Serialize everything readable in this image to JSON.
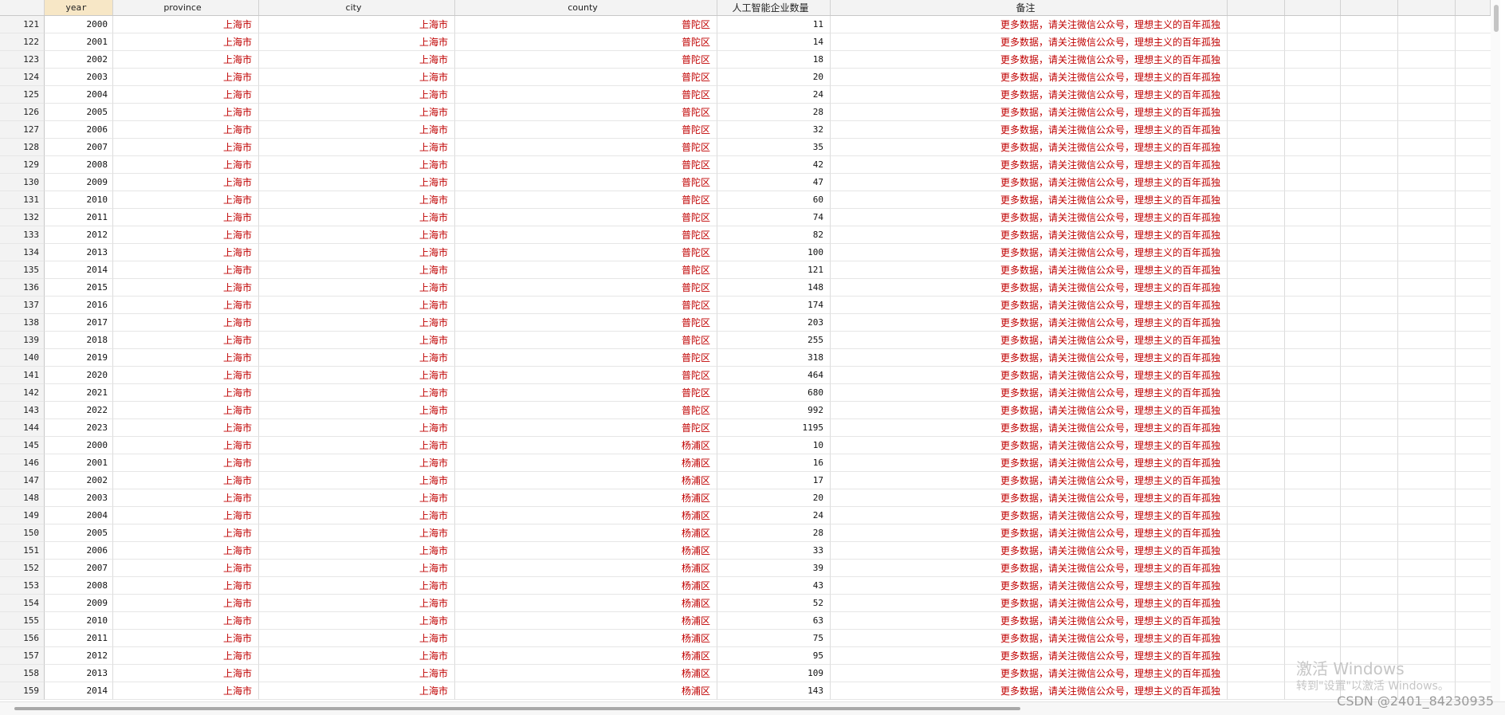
{
  "columns": [
    "year",
    "province",
    "city",
    "county",
    "人工智能企业数量",
    "备注"
  ],
  "rows": [
    {
      "rn": "121",
      "year": "2000",
      "province": "上海市",
      "city": "上海市",
      "county": "普陀区",
      "count": "11",
      "note": "更多数据，请关注微信公众号，理想主义的百年孤独"
    },
    {
      "rn": "122",
      "year": "2001",
      "province": "上海市",
      "city": "上海市",
      "county": "普陀区",
      "count": "14",
      "note": "更多数据，请关注微信公众号，理想主义的百年孤独"
    },
    {
      "rn": "123",
      "year": "2002",
      "province": "上海市",
      "city": "上海市",
      "county": "普陀区",
      "count": "18",
      "note": "更多数据，请关注微信公众号，理想主义的百年孤独"
    },
    {
      "rn": "124",
      "year": "2003",
      "province": "上海市",
      "city": "上海市",
      "county": "普陀区",
      "count": "20",
      "note": "更多数据，请关注微信公众号，理想主义的百年孤独"
    },
    {
      "rn": "125",
      "year": "2004",
      "province": "上海市",
      "city": "上海市",
      "county": "普陀区",
      "count": "24",
      "note": "更多数据，请关注微信公众号，理想主义的百年孤独"
    },
    {
      "rn": "126",
      "year": "2005",
      "province": "上海市",
      "city": "上海市",
      "county": "普陀区",
      "count": "28",
      "note": "更多数据，请关注微信公众号，理想主义的百年孤独"
    },
    {
      "rn": "127",
      "year": "2006",
      "province": "上海市",
      "city": "上海市",
      "county": "普陀区",
      "count": "32",
      "note": "更多数据，请关注微信公众号，理想主义的百年孤独"
    },
    {
      "rn": "128",
      "year": "2007",
      "province": "上海市",
      "city": "上海市",
      "county": "普陀区",
      "count": "35",
      "note": "更多数据，请关注微信公众号，理想主义的百年孤独"
    },
    {
      "rn": "129",
      "year": "2008",
      "province": "上海市",
      "city": "上海市",
      "county": "普陀区",
      "count": "42",
      "note": "更多数据，请关注微信公众号，理想主义的百年孤独"
    },
    {
      "rn": "130",
      "year": "2009",
      "province": "上海市",
      "city": "上海市",
      "county": "普陀区",
      "count": "47",
      "note": "更多数据，请关注微信公众号，理想主义的百年孤独"
    },
    {
      "rn": "131",
      "year": "2010",
      "province": "上海市",
      "city": "上海市",
      "county": "普陀区",
      "count": "60",
      "note": "更多数据，请关注微信公众号，理想主义的百年孤独"
    },
    {
      "rn": "132",
      "year": "2011",
      "province": "上海市",
      "city": "上海市",
      "county": "普陀区",
      "count": "74",
      "note": "更多数据，请关注微信公众号，理想主义的百年孤独"
    },
    {
      "rn": "133",
      "year": "2012",
      "province": "上海市",
      "city": "上海市",
      "county": "普陀区",
      "count": "82",
      "note": "更多数据，请关注微信公众号，理想主义的百年孤独"
    },
    {
      "rn": "134",
      "year": "2013",
      "province": "上海市",
      "city": "上海市",
      "county": "普陀区",
      "count": "100",
      "note": "更多数据，请关注微信公众号，理想主义的百年孤独"
    },
    {
      "rn": "135",
      "year": "2014",
      "province": "上海市",
      "city": "上海市",
      "county": "普陀区",
      "count": "121",
      "note": "更多数据，请关注微信公众号，理想主义的百年孤独"
    },
    {
      "rn": "136",
      "year": "2015",
      "province": "上海市",
      "city": "上海市",
      "county": "普陀区",
      "count": "148",
      "note": "更多数据，请关注微信公众号，理想主义的百年孤独"
    },
    {
      "rn": "137",
      "year": "2016",
      "province": "上海市",
      "city": "上海市",
      "county": "普陀区",
      "count": "174",
      "note": "更多数据，请关注微信公众号，理想主义的百年孤独"
    },
    {
      "rn": "138",
      "year": "2017",
      "province": "上海市",
      "city": "上海市",
      "county": "普陀区",
      "count": "203",
      "note": "更多数据，请关注微信公众号，理想主义的百年孤独"
    },
    {
      "rn": "139",
      "year": "2018",
      "province": "上海市",
      "city": "上海市",
      "county": "普陀区",
      "count": "255",
      "note": "更多数据，请关注微信公众号，理想主义的百年孤独"
    },
    {
      "rn": "140",
      "year": "2019",
      "province": "上海市",
      "city": "上海市",
      "county": "普陀区",
      "count": "318",
      "note": "更多数据，请关注微信公众号，理想主义的百年孤独"
    },
    {
      "rn": "141",
      "year": "2020",
      "province": "上海市",
      "city": "上海市",
      "county": "普陀区",
      "count": "464",
      "note": "更多数据，请关注微信公众号，理想主义的百年孤独"
    },
    {
      "rn": "142",
      "year": "2021",
      "province": "上海市",
      "city": "上海市",
      "county": "普陀区",
      "count": "680",
      "note": "更多数据，请关注微信公众号，理想主义的百年孤独"
    },
    {
      "rn": "143",
      "year": "2022",
      "province": "上海市",
      "city": "上海市",
      "county": "普陀区",
      "count": "992",
      "note": "更多数据，请关注微信公众号，理想主义的百年孤独"
    },
    {
      "rn": "144",
      "year": "2023",
      "province": "上海市",
      "city": "上海市",
      "county": "普陀区",
      "count": "1195",
      "note": "更多数据，请关注微信公众号，理想主义的百年孤独"
    },
    {
      "rn": "145",
      "year": "2000",
      "province": "上海市",
      "city": "上海市",
      "county": "杨浦区",
      "count": "10",
      "note": "更多数据，请关注微信公众号，理想主义的百年孤独"
    },
    {
      "rn": "146",
      "year": "2001",
      "province": "上海市",
      "city": "上海市",
      "county": "杨浦区",
      "count": "16",
      "note": "更多数据，请关注微信公众号，理想主义的百年孤独"
    },
    {
      "rn": "147",
      "year": "2002",
      "province": "上海市",
      "city": "上海市",
      "county": "杨浦区",
      "count": "17",
      "note": "更多数据，请关注微信公众号，理想主义的百年孤独"
    },
    {
      "rn": "148",
      "year": "2003",
      "province": "上海市",
      "city": "上海市",
      "county": "杨浦区",
      "count": "20",
      "note": "更多数据，请关注微信公众号，理想主义的百年孤独"
    },
    {
      "rn": "149",
      "year": "2004",
      "province": "上海市",
      "city": "上海市",
      "county": "杨浦区",
      "count": "24",
      "note": "更多数据，请关注微信公众号，理想主义的百年孤独"
    },
    {
      "rn": "150",
      "year": "2005",
      "province": "上海市",
      "city": "上海市",
      "county": "杨浦区",
      "count": "28",
      "note": "更多数据，请关注微信公众号，理想主义的百年孤独"
    },
    {
      "rn": "151",
      "year": "2006",
      "province": "上海市",
      "city": "上海市",
      "county": "杨浦区",
      "count": "33",
      "note": "更多数据，请关注微信公众号，理想主义的百年孤独"
    },
    {
      "rn": "152",
      "year": "2007",
      "province": "上海市",
      "city": "上海市",
      "county": "杨浦区",
      "count": "39",
      "note": "更多数据，请关注微信公众号，理想主义的百年孤独"
    },
    {
      "rn": "153",
      "year": "2008",
      "province": "上海市",
      "city": "上海市",
      "county": "杨浦区",
      "count": "43",
      "note": "更多数据，请关注微信公众号，理想主义的百年孤独"
    },
    {
      "rn": "154",
      "year": "2009",
      "province": "上海市",
      "city": "上海市",
      "county": "杨浦区",
      "count": "52",
      "note": "更多数据，请关注微信公众号，理想主义的百年孤独"
    },
    {
      "rn": "155",
      "year": "2010",
      "province": "上海市",
      "city": "上海市",
      "county": "杨浦区",
      "count": "63",
      "note": "更多数据，请关注微信公众号，理想主义的百年孤独"
    },
    {
      "rn": "156",
      "year": "2011",
      "province": "上海市",
      "city": "上海市",
      "county": "杨浦区",
      "count": "75",
      "note": "更多数据，请关注微信公众号，理想主义的百年孤独"
    },
    {
      "rn": "157",
      "year": "2012",
      "province": "上海市",
      "city": "上海市",
      "county": "杨浦区",
      "count": "95",
      "note": "更多数据，请关注微信公众号，理想主义的百年孤独"
    },
    {
      "rn": "158",
      "year": "2013",
      "province": "上海市",
      "city": "上海市",
      "county": "杨浦区",
      "count": "109",
      "note": "更多数据，请关注微信公众号，理想主义的百年孤独"
    },
    {
      "rn": "159",
      "year": "2014",
      "province": "上海市",
      "city": "上海市",
      "county": "杨浦区",
      "count": "143",
      "note": "更多数据，请关注微信公众号，理想主义的百年孤独"
    }
  ],
  "watermark": {
    "title": "激活 Windows",
    "subtitle": "转到\"设置\"以激活 Windows。"
  },
  "credit": "CSDN @2401_84230935"
}
